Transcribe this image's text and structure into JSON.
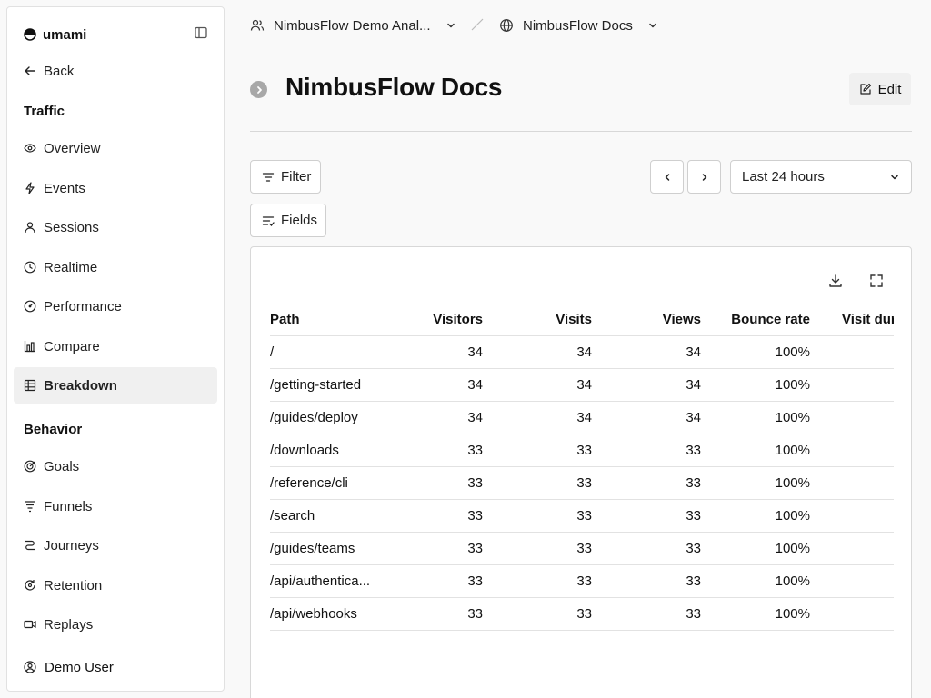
{
  "sidebar": {
    "brand": "umami",
    "back": "Back",
    "sections": [
      {
        "title": "Traffic"
      },
      {
        "title": "Behavior"
      }
    ],
    "traffic_items": [
      {
        "label": "Overview",
        "icon": "eye-icon"
      },
      {
        "label": "Events",
        "icon": "lightning-icon"
      },
      {
        "label": "Sessions",
        "icon": "user-icon"
      },
      {
        "label": "Realtime",
        "icon": "clock-icon"
      },
      {
        "label": "Performance",
        "icon": "gauge-icon"
      },
      {
        "label": "Compare",
        "icon": "bar-chart-icon"
      },
      {
        "label": "Breakdown",
        "icon": "grid-icon",
        "active": true
      }
    ],
    "behavior_items": [
      {
        "label": "Goals",
        "icon": "target-icon"
      },
      {
        "label": "Funnels",
        "icon": "funnel-icon"
      },
      {
        "label": "Journeys",
        "icon": "route-icon"
      },
      {
        "label": "Retention",
        "icon": "refresh-icon"
      },
      {
        "label": "Replays",
        "icon": "video-icon"
      }
    ],
    "user": "Demo User"
  },
  "header": {
    "team": "NimbusFlow Demo Anal...",
    "website": "NimbusFlow Docs"
  },
  "page": {
    "title": "NimbusFlow Docs",
    "edit_label": "Edit"
  },
  "controls": {
    "filter_label": "Filter",
    "fields_label": "Fields",
    "date_range": "Last 24 hours"
  },
  "table": {
    "columns": [
      "Path",
      "Visitors",
      "Visits",
      "Views",
      "Bounce rate",
      "Visit dur"
    ],
    "rows": [
      [
        "/",
        "34",
        "34",
        "34",
        "100%"
      ],
      [
        "/getting-started",
        "34",
        "34",
        "34",
        "100%"
      ],
      [
        "/guides/deploy",
        "34",
        "34",
        "34",
        "100%"
      ],
      [
        "/downloads",
        "33",
        "33",
        "33",
        "100%"
      ],
      [
        "/reference/cli",
        "33",
        "33",
        "33",
        "100%"
      ],
      [
        "/search",
        "33",
        "33",
        "33",
        "100%"
      ],
      [
        "/guides/teams",
        "33",
        "33",
        "33",
        "100%"
      ],
      [
        "/api/authentica...",
        "33",
        "33",
        "33",
        "100%"
      ],
      [
        "/api/webhooks",
        "33",
        "33",
        "33",
        "100%"
      ]
    ]
  }
}
